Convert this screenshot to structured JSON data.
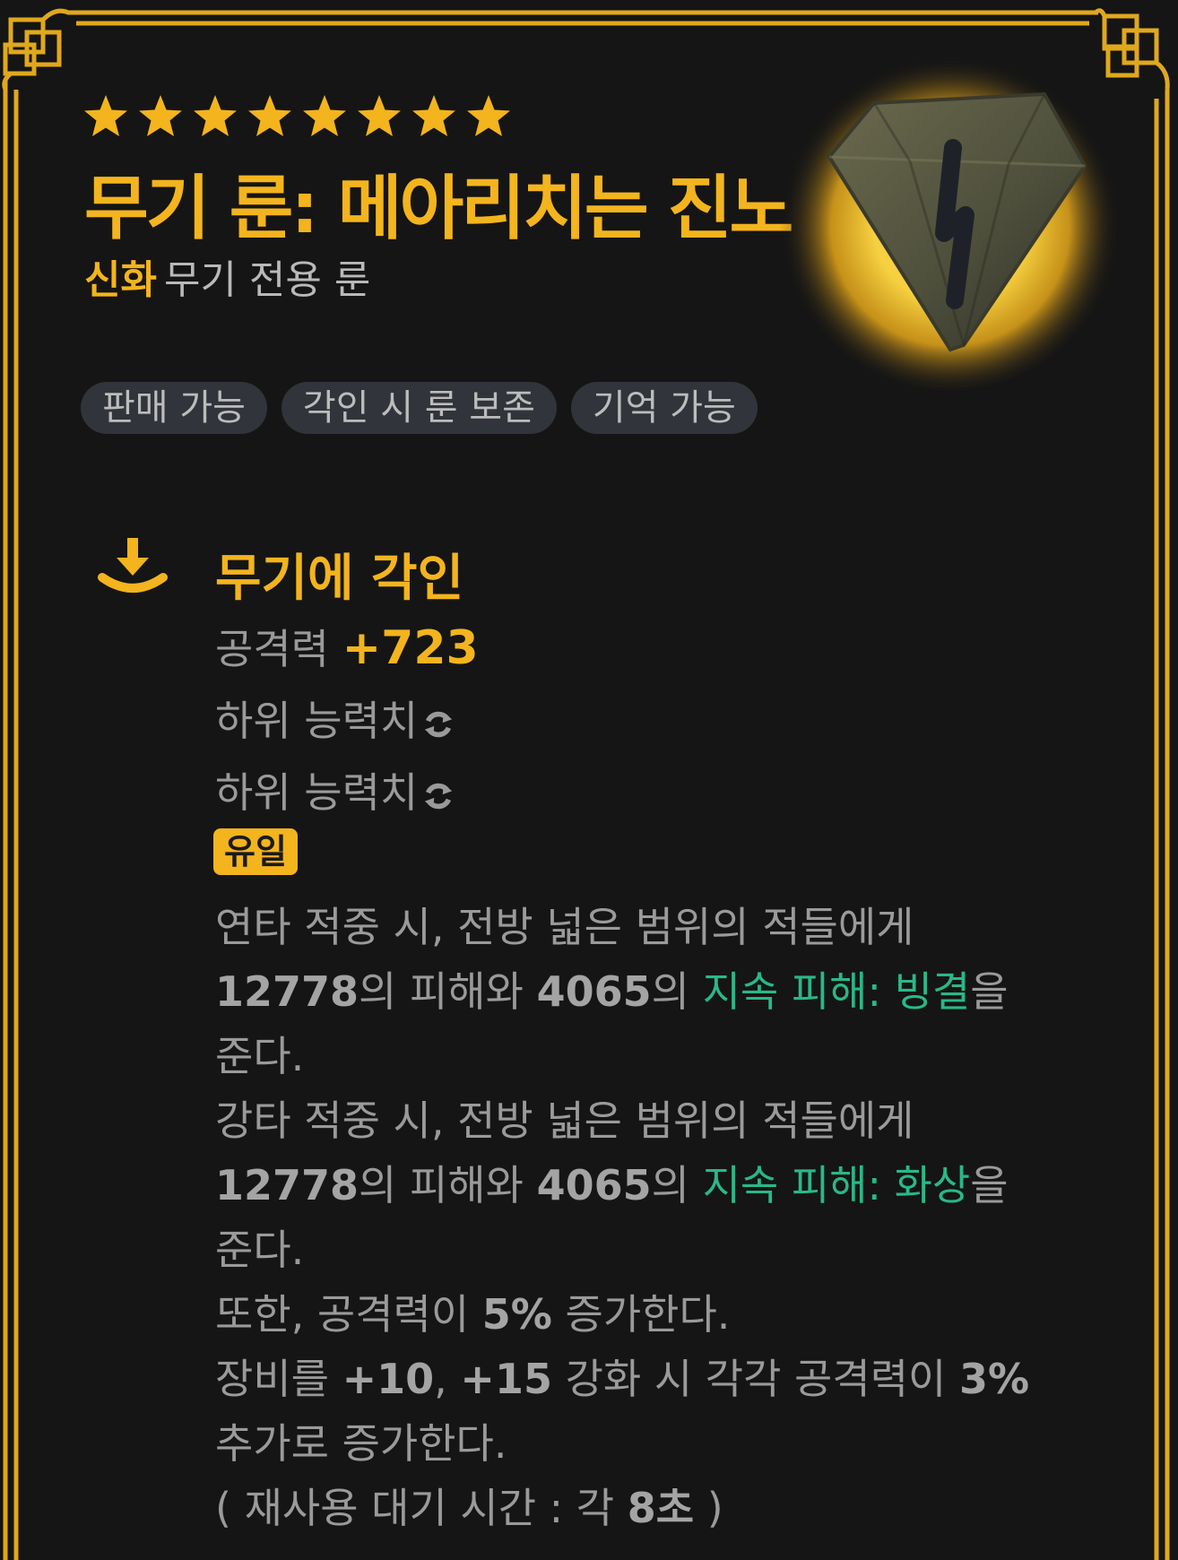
{
  "item": {
    "star_count": 8,
    "title": "무기 룬: 메아리치는 진노",
    "grade": "신화",
    "type": "무기 전용 룬",
    "rune_icon": "rune-stone-icon",
    "tags": [
      "판매 가능",
      "각인 시 룬 보존",
      "기억 가능"
    ]
  },
  "engrave": {
    "icon": "engrave-download-icon",
    "title": "무기에 각인",
    "attack_label": "공격력",
    "attack_value": "+723",
    "substat_1": "하위 능력치",
    "substat_2": "하위 능력치",
    "unique_badge": "유일"
  },
  "effect": {
    "l1": "연타 적중 시, 전방 넓은 범위의 적들에게",
    "l2_v1": "12778",
    "l2_t1": "의 피해와",
    "l2_v2": "4065",
    "l2_t2": "의",
    "l2_dot": "지속 피해: 빙결",
    "l2_t3": "을",
    "l3": "준다.",
    "l4": "강타 적중 시, 전방 넓은 범위의 적들에게",
    "l5_v1": "12778",
    "l5_t1": "의 피해와",
    "l5_v2": "4065",
    "l5_t2": "의",
    "l5_dot": "지속 피해: 화상",
    "l5_t3": "을",
    "l6": "준다.",
    "l7_t1": "또한, 공격력이",
    "l7_v1": "5%",
    "l7_t2": "증가한다.",
    "l8_t1": "장비를",
    "l8_v1": "+10",
    "l8_t2": ",",
    "l8_v2": "+15",
    "l8_t3": "강화 시 각각 공격력이",
    "l8_v3": "3%",
    "l9": "추가로 증가한다.",
    "l10_t1": "( 재사용 대기 시간 : 각",
    "l10_v1": "8초",
    "l10_t2": ")"
  },
  "colors": {
    "gold": "#f3b41d",
    "dot_green": "#29b889",
    "text_gray": "#9a9a9a",
    "background": "#151515"
  }
}
